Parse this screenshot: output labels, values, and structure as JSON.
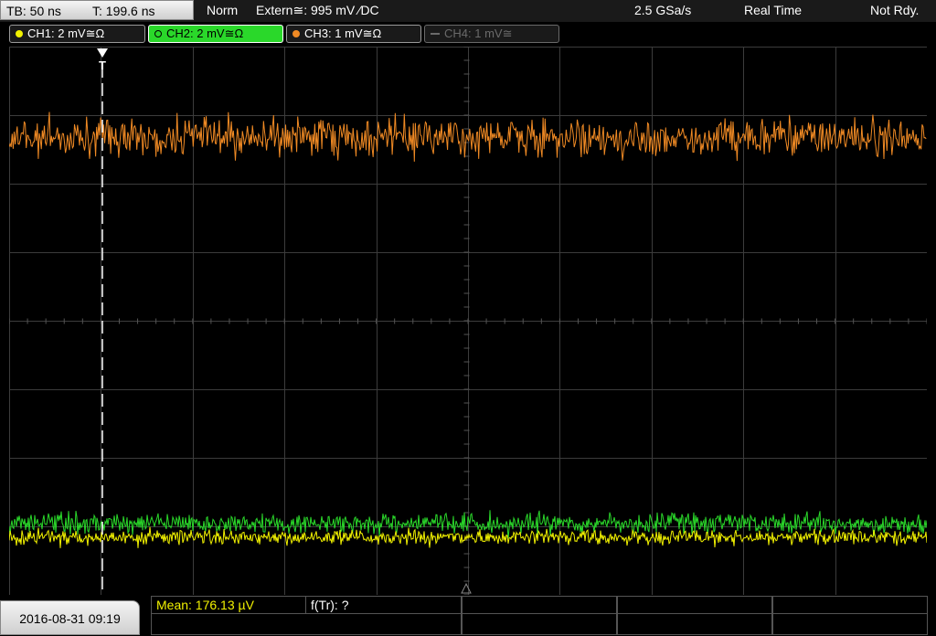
{
  "header": {
    "timebase": "TB: 50 ns",
    "trigger_time": "T: 199.6 ns",
    "trigger_mode": "Norm",
    "trigger_source": "Extern≅: 995 mV ⁄DC",
    "sample_rate": "2.5 GSa/s",
    "acq_mode": "Real Time",
    "status": "Not Rdy."
  },
  "channels": [
    {
      "label": "CH1: 2 mV≅Ω",
      "color": "#f2f200",
      "state": "on"
    },
    {
      "label": "CH2: 2 mV≅Ω",
      "color": "#2ad82a",
      "state": "selected"
    },
    {
      "label": "CH3: 1 mV≅Ω",
      "color": "#f08a24",
      "state": "on"
    },
    {
      "label": "CH4: 1 mV≅",
      "color": "#6a6a6a",
      "state": "off"
    }
  ],
  "screen": {
    "trigger_marker": "T",
    "grid_color": "#3c3c3c",
    "traces": [
      {
        "channel": "CH3",
        "color": "#f08a24"
      },
      {
        "channel": "CH2",
        "color": "#2ad82a"
      },
      {
        "channel": "CH1",
        "color": "#f2f200"
      }
    ]
  },
  "footer": {
    "datetime": "2016-08-31 09:19",
    "mean": "Mean: 176.13 µV",
    "frequency": "f(Tr): ?"
  }
}
